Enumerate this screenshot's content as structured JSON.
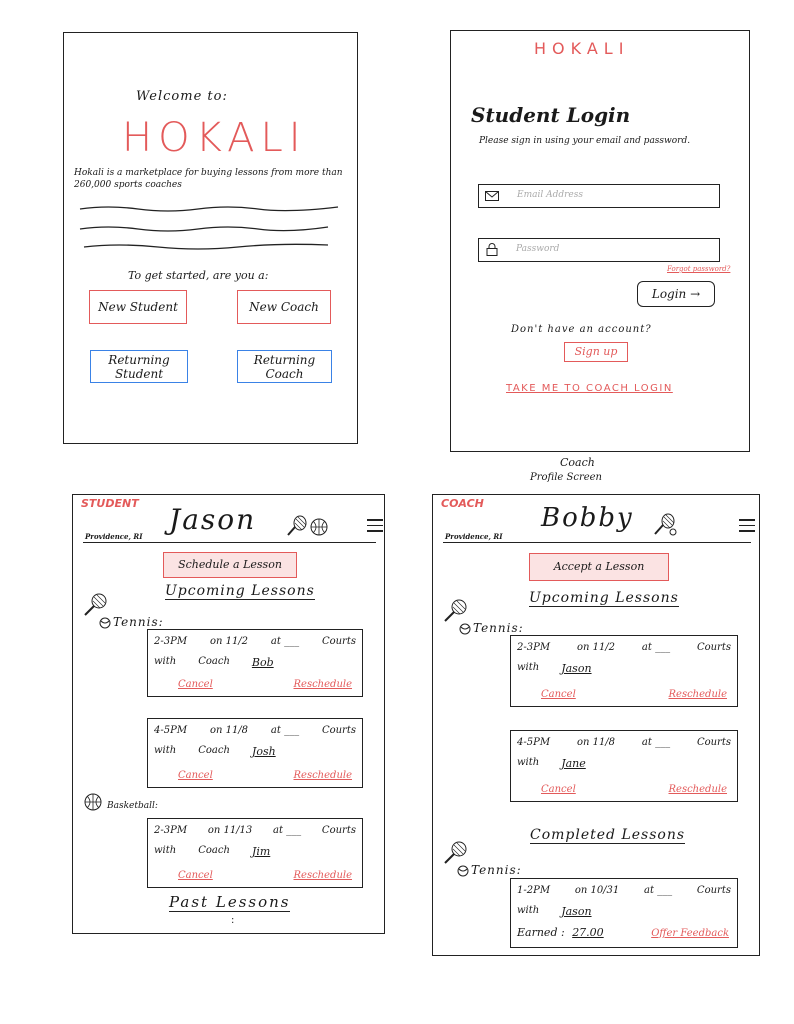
{
  "welcome": {
    "heading": "Welcome to:",
    "brand": "HOKALI",
    "desc": "Hokali is a marketplace for buying lessons from more than 260,000 sports coaches",
    "prompt": "To get started, are you a:",
    "buttons": {
      "new_student": "New Student",
      "new_coach": "New Coach",
      "returning_student": "Returning Student",
      "returning_coach": "Returning Coach"
    }
  },
  "login": {
    "brand": "HOKALI",
    "title": "Student Login",
    "subtitle": "Please sign in using your email and password.",
    "email_placeholder": "Email Address",
    "password_placeholder": "Password",
    "forgot": "Forgot password?",
    "login_button": "Login →",
    "no_account": "Don't have an account?",
    "signup": "Sign up",
    "coach_login": "TAKE ME TO COACH LOGIN"
  },
  "annotation": {
    "line1": "Coach",
    "line2": "Profile Screen"
  },
  "student_profile": {
    "role": "STUDENT",
    "name": "Jason",
    "location": "Providence, RI",
    "action_button": "Schedule a Lesson",
    "upcoming_heading": "Upcoming Lessons",
    "tennis_label": "Tennis:",
    "basketball_label": "Basketball:",
    "lessons": [
      {
        "time": "2-3PM",
        "date": "on 11/2",
        "at": "at ___",
        "place": "Courts",
        "with": "with",
        "coach_word": "Coach",
        "coach": "Bob",
        "cancel": "Cancel",
        "reschedule": "Reschedule"
      },
      {
        "time": "4-5PM",
        "date": "on 11/8",
        "at": "at ___",
        "place": "Courts",
        "with": "with",
        "coach_word": "Coach",
        "coach": "Josh",
        "cancel": "Cancel",
        "reschedule": "Reschedule"
      },
      {
        "time": "2-3PM",
        "date": "on 11/13",
        "at": "at ___",
        "place": "Courts",
        "with": "with",
        "coach_word": "Coach",
        "coach": "Jim",
        "cancel": "Cancel",
        "reschedule": "Reschedule"
      }
    ],
    "past_heading": "Past Lessons",
    "more": ":"
  },
  "coach_profile": {
    "role": "COACH",
    "name": "Bobby",
    "location": "Providence, RI",
    "action_button": "Accept a Lesson",
    "upcoming_heading": "Upcoming Lessons",
    "tennis_label": "Tennis:",
    "lessons": [
      {
        "time": "2-3PM",
        "date": "on 11/2",
        "at": "at ___",
        "place": "Courts",
        "with": "with",
        "student": "Jason",
        "cancel": "Cancel",
        "reschedule": "Reschedule"
      },
      {
        "time": "4-5PM",
        "date": "on 11/8",
        "at": "at ___",
        "place": "Courts",
        "with": "with",
        "student": "Jane",
        "cancel": "Cancel",
        "reschedule": "Reschedule"
      }
    ],
    "completed_heading": "Completed Lessons",
    "completed_tennis_label": "Tennis:",
    "completed": {
      "time": "1-2PM",
      "date": "on 10/31",
      "at": "at ___",
      "place": "Courts",
      "with": "with",
      "student": "Jason",
      "earned_label": "Earned :",
      "earned": "27.00",
      "feedback": "Offer Feedback"
    }
  },
  "colors": {
    "accent_red": "#e35a5a",
    "accent_blue": "#3a82e6",
    "ink": "#222222"
  }
}
